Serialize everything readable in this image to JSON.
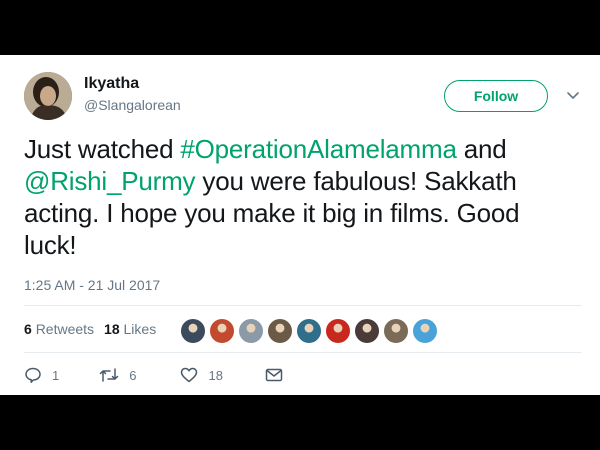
{
  "user": {
    "display_name": "Ikyatha",
    "handle": "@Slangalorean"
  },
  "follow_button": {
    "label": "Follow"
  },
  "tweet": {
    "text_before": "Just watched ",
    "hashtag": "#OperationAlamelamma",
    "text_middle": " and ",
    "mention": "@Rishi_Purmy",
    "text_after": " you were fabulous! Sakkath acting. I hope you make it big in films. Good luck!",
    "timestamp": "1:25 AM - 21 Jul 2017"
  },
  "stats": {
    "retweets_count": "6",
    "retweets_label": "Retweets",
    "likes_count": "18",
    "likes_label": "Likes"
  },
  "likers": [
    {
      "color": "#3b4a5c"
    },
    {
      "color": "#c24a2e"
    },
    {
      "color": "#8c9aa8"
    },
    {
      "color": "#6b5a48"
    },
    {
      "color": "#2f6f8c"
    },
    {
      "color": "#c8281e"
    },
    {
      "color": "#4a3a3a"
    },
    {
      "color": "#7a6a58"
    },
    {
      "color": "#4aa3d8"
    }
  ],
  "actions": {
    "reply_count": "1",
    "retweet_count": "6",
    "like_count": "18"
  },
  "icons": {
    "reply": "reply-icon",
    "retweet": "retweet-icon",
    "like": "heart-icon",
    "message": "envelope-icon",
    "more": "chevron-down-icon"
  },
  "colors": {
    "accent": "#00a36c",
    "text": "#14171a",
    "muted": "#657786"
  }
}
